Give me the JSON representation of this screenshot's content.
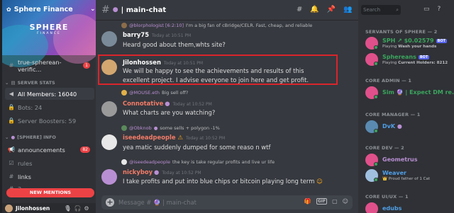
{
  "server": {
    "name": "Sphere Finance",
    "banner_title": "SPHERE",
    "banner_sub": "FINANCE"
  },
  "channels": {
    "verify": {
      "name": "true-spherean-verific...",
      "badge": "1"
    },
    "stats_category": "SERVER STATS",
    "all_members": "All Members: 16040",
    "bots": "Bots: 24",
    "boosters": "Server Boosters: 59",
    "info_category": "[SPHERE] INFO",
    "announcements": {
      "name": "announcements",
      "badge": "82"
    },
    "rules": "rules",
    "links": "links",
    "partial": "2 ..."
  },
  "new_mentions": "NEW MENTIONS",
  "user_panel": {
    "name": "Jilonhossen"
  },
  "chat": {
    "channel": "| main-chat",
    "composer_placeholder": "Message # 🔮 | main-chat",
    "messages": [
      {
        "reply_user": "@blorphologist [6:2:10]",
        "reply_text": "I'm a big fan of cBridge/CELR. Fast, cheap, and reliable",
        "user": "barry75",
        "time": "Today at 10:51 PM",
        "text": "Heard good about them,whts site?"
      },
      {
        "user": "Jilonhossen",
        "time": "Today at 10:51 PM",
        "text": "We will be happy to see the achievements and results of this excellent project. I advise everyone to join here and get profit."
      },
      {
        "reply_user": "@MOUSE.eth",
        "reply_text": "Big sell off?",
        "user": "Connotative",
        "time": "Today at 10:52 PM",
        "text": "What charts are you watching?"
      },
      {
        "reply_user": "@Obknob",
        "reply_text": "some sells + polygon -1%",
        "user": "iseedeadpeople",
        "time": "Today at 10:52 PM",
        "text": "yea matic suddenly dumped for some reaso n wtf"
      },
      {
        "reply_user": "@iseedeadpeople",
        "reply_text": "the key is take regular profits and live ur life",
        "user": "nickyboy",
        "time": "Today at 10:52 PM",
        "text": "I take profits and put into blue chips or bitcoin playing long term"
      }
    ]
  },
  "members": {
    "search_placeholder": "Search",
    "groups": [
      {
        "title": "SERVANTS OF SPHERE — 2"
      },
      {
        "title": "CORE ADMIN — 1"
      },
      {
        "title": "CORE MANAGER — 1"
      },
      {
        "title": "CORE DEV — 2"
      },
      {
        "title": "CORE UI/UX — 1"
      }
    ],
    "list": [
      {
        "name": "SPH ↗ $0.02579",
        "bot": "BOT",
        "sub_prefix": "Playing ",
        "sub": "Wash your hands"
      },
      {
        "name": "Sphereans",
        "bot": "BOT",
        "sub_prefix": "Playing ",
        "sub": "Current Holders: 8212"
      },
      {
        "name": "Sim 🔮 | Expect DM re..."
      },
      {
        "name": "DvK"
      },
      {
        "name": "Geometrus"
      },
      {
        "name": "Weaver",
        "sub": "👑 Proud father of 1 Cat"
      },
      {
        "name": "edubs"
      }
    ]
  },
  "colors": {
    "accent_red": "#d9252b",
    "mention_red": "#ed4245",
    "connotative": "#f47b67",
    "green": "#3ba55d",
    "purple_name": "#b98fd3",
    "blue_name": "#4f9fe8"
  }
}
